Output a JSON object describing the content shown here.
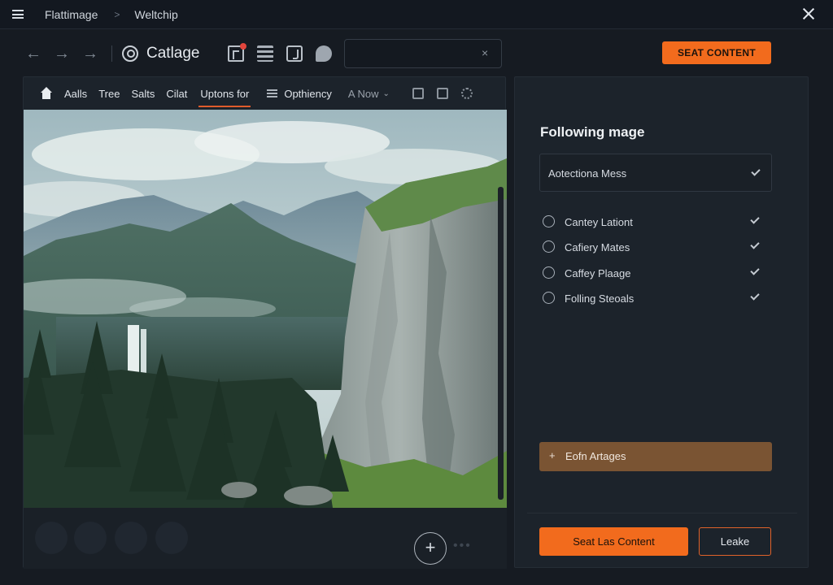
{
  "titlebar": {
    "crumb_1": "Flattimage",
    "crumb_separator": ">",
    "crumb_2": "Weltchip",
    "menu_icon": "hamburger-menu-icon",
    "close_icon": "close-icon"
  },
  "toolbar": {
    "app_title": "Catlage",
    "nav_icons": [
      "arrow-left-icon",
      "arrow-right-icon",
      "arrow-right-icon"
    ],
    "action_icons": [
      "document-icon",
      "stack-icon",
      "music-note-icon",
      "chat-bubble-icon"
    ],
    "notification_badge_color": "#e2453c",
    "search": {
      "value": "",
      "placeholder": "",
      "clear_glyph": "×"
    },
    "seat_button_label": "SEAT CONTENT"
  },
  "tabs": {
    "items": [
      "Aalls",
      "Tree",
      "Salts",
      "Cilat",
      "Uptons for"
    ],
    "active_index": 4,
    "extra_tab": "Opthiency",
    "now_label": "A Now",
    "caret_glyph": "⌄",
    "tool_icons": [
      "home-outline-icon",
      "file-icon",
      "gear-icon"
    ]
  },
  "viewer": {
    "image_subject": "mountain-landscape-with-waterfall-and-cliff",
    "add_glyph": "+",
    "more_glyph": "•••"
  },
  "right_panel": {
    "title": "Following mage",
    "dropdown": {
      "value": "Aotectiona Mess"
    },
    "options": [
      {
        "label": "Cantey Lationt"
      },
      {
        "label": "Cafiery Mates"
      },
      {
        "label": "Caffey Plaage"
      },
      {
        "label": "Folling Steoals"
      }
    ],
    "tag": {
      "plus": "+",
      "label": "Eofn Artages"
    },
    "primary_button": "Seat Las Content",
    "secondary_button": "Leake"
  },
  "colors": {
    "accent": "#f26b1d",
    "background": "#161b22",
    "panel": "#1c232b",
    "tag_brown": "#7a5433"
  }
}
